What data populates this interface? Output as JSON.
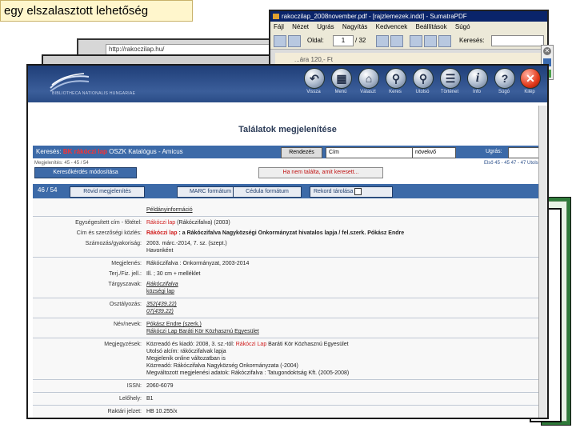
{
  "slide": {
    "title": "egy elszalasztott lehetőség"
  },
  "back_browser": {
    "url": "http://rakoczilap.hu/"
  },
  "pdf_viewer": {
    "title": "rakoczilap_2008november.pdf - [rajzlemezek.indd] - SumatraPDF",
    "menu": [
      "Fájl",
      "Nézet",
      "Ugrás",
      "Nagyítás",
      "Kedvencek",
      "Beállítások",
      "Súgó"
    ],
    "page_label": "Oldal:",
    "page_value": "1",
    "page_total": "/ 32",
    "search_label": "Keresés:",
    "page_text": "...ára 120,- Ft"
  },
  "catalog": {
    "library_name": "BIBLIOTHECA NATIONALIS HUNGARIAE",
    "nav": [
      {
        "label": "Vissza",
        "glyph": "↶",
        "icon": "back-icon"
      },
      {
        "label": "Menü",
        "glyph": "▦",
        "icon": "menu-icon"
      },
      {
        "label": "Választ",
        "glyph": "⌂",
        "icon": "library-icon"
      },
      {
        "label": "Keres",
        "glyph": "⚲",
        "icon": "search-icon"
      },
      {
        "label": "Utolsó",
        "glyph": "⚲",
        "icon": "last-search-icon"
      },
      {
        "label": "Történet",
        "glyph": "☰",
        "icon": "history-icon"
      },
      {
        "label": "Info",
        "glyph": "i",
        "icon": "info-icon"
      },
      {
        "label": "Súgó",
        "glyph": "?",
        "icon": "help-icon"
      },
      {
        "label": "Kilép",
        "glyph": "✕",
        "icon": "exit-icon"
      }
    ],
    "page_title": "Találatok megjelenítése",
    "search_prefix": "Keresés:",
    "search_term": "BK rákóczi lap",
    "search_suffix": "OSZK Katalógus - Amicus",
    "sort_button": "Rendezés",
    "sort_field": "Cím",
    "sort_order": "növekvő",
    "jump_label": "Ugrás:",
    "display_info": "Megjelenítés: 45 - 45 / 54",
    "nav_links": "Első 45 - 45 47 - 47 Utolsó",
    "modify_button": "Keresőkérdés módosítása",
    "notfound_button": "Ha nem találta, amit keresett...",
    "record_count": "46 / 54",
    "tabs": [
      "Rövid megjelenítés",
      "MARC formátum",
      "Cédula formátum",
      "Rekord tárolása"
    ],
    "details": [
      {
        "key": "",
        "value": "Példányinformáció",
        "link": true
      },
      {
        "key": "Egységesített cím - főtétel:",
        "value_red": "Rákóczi lap",
        "value": " (Rákóczifalva) (2003)"
      },
      {
        "key": "Cím és szerzőségi közlés:",
        "value_red": "Rákóczi lap",
        "value": " : a Rákóczifalva Nagyközségi Önkormányzat hivatalos lapja / fel.szerk. Pókász Endre",
        "bold": true
      },
      {
        "key": "Számozás/gyakoriság:",
        "value": "2003. márc.-2014, 7. sz. (szept.)"
      },
      {
        "key": "",
        "value": "Havonként"
      },
      {
        "key": "Megjelenés:",
        "value": "Rákóczifalva : Önkormányzat, 2003-2014"
      },
      {
        "key": "Terj./Fiz. jell.:",
        "value": "Ill. ; 30 cm + melléklet"
      },
      {
        "key": "Tárgyszavak:",
        "value": "Rákóczifalva",
        "link": true,
        "italic": true
      },
      {
        "key": "",
        "value": "községi lap",
        "link": true
      },
      {
        "key": "Osztályozás:",
        "value": "352(439.22)",
        "link": true,
        "italic": true
      },
      {
        "key": "",
        "value": "07(439.22)",
        "link": true,
        "italic": true
      },
      {
        "key": "Név/nevek:",
        "value": "Pókász Endre (szerk.)",
        "link": true
      },
      {
        "key": "",
        "value": "Rákóczi Lap Baráti Kör Közhasznú Egyesület",
        "link": true
      },
      {
        "key": "Megjegyzések:",
        "value": "Közreadó és kiadó: 2008, 3. sz.-tól: ",
        "value_red_after": "Rákóczi Lap",
        "value_tail": " Baráti Kör Közhasznú Egyesület"
      },
      {
        "key": "",
        "value": "Utolsó alcím: rákóczifalvak lapja"
      },
      {
        "key": "",
        "value": "Megjelenik online változatban is"
      },
      {
        "key": "",
        "value": "Közreadó: Rákóczifalva Nagyközség Önkormányzata (-2004)"
      },
      {
        "key": "",
        "value": "Megváltozott megjelenési adatok: Rákóczifalva : Tatugondoktság Kft. (2005-2008)"
      },
      {
        "key": "ISSN:",
        "value": "2060-6079"
      },
      {
        "key": "Lelőhely:",
        "value": "B1"
      },
      {
        "key": "Raktári jelzet:",
        "value": "HB 10.255/x"
      }
    ]
  },
  "colors": {
    "header": "#2a4c86",
    "bar": "#3c6aa8",
    "highlight": "#d01a1a",
    "title_bg": "#fff6cc"
  }
}
